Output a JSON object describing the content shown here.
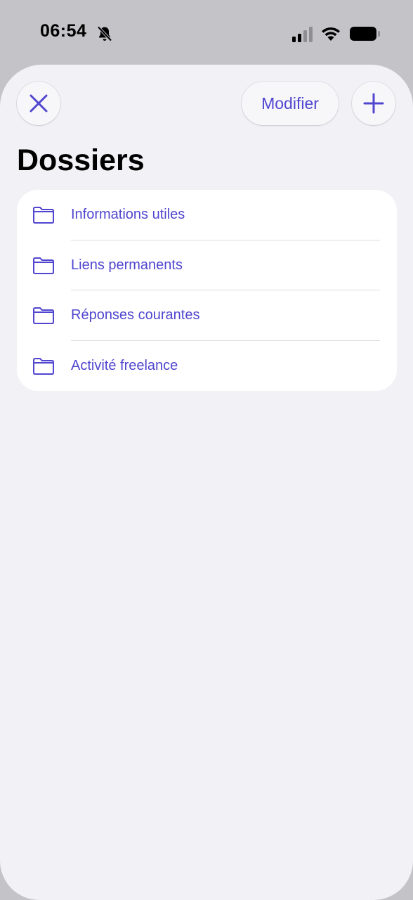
{
  "status_bar": {
    "time": "06:54",
    "icons": [
      "bell-slash-icon",
      "cellular-signal-icon",
      "wifi-icon",
      "battery-icon"
    ]
  },
  "header": {
    "close_icon": "close-icon",
    "edit_label": "Modifier",
    "add_icon": "plus-icon"
  },
  "title": "Dossiers",
  "folders": [
    {
      "label": "Informations utiles",
      "icon": "folder-icon"
    },
    {
      "label": "Liens permanents",
      "icon": "folder-icon"
    },
    {
      "label": "Réponses courantes",
      "icon": "folder-icon"
    },
    {
      "label": "Activité freelance",
      "icon": "folder-icon"
    }
  ],
  "colors": {
    "accent": "#5046cf",
    "sheet_background": "#f1f1f6",
    "list_background": "#ffffff",
    "backdrop": "#c4c4c8"
  }
}
